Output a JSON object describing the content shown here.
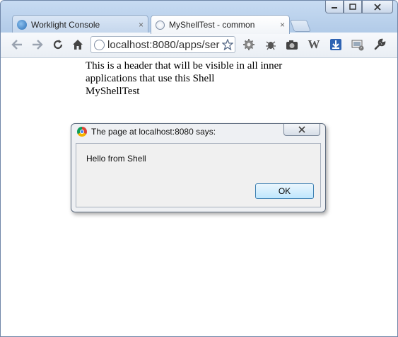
{
  "browser": {
    "tabs": [
      {
        "label": "Worklight Console",
        "icon": "worklight-icon"
      },
      {
        "label": "MyShellTest - common",
        "icon": "globe-icon"
      }
    ],
    "tab_close_glyph": "×",
    "address": {
      "url": "localhost:8080/apps/ser"
    },
    "toolbar_icons": [
      "back-icon",
      "forward-icon",
      "reload-icon",
      "home-icon",
      "star-icon",
      "gear-icon",
      "bug-icon",
      "camera-icon",
      "w-icon",
      "download-icon",
      "monitor-icon",
      "wrench-icon"
    ]
  },
  "page": {
    "header_text": "This is a header that will be visible in all inner applications that use this Shell",
    "app_name": "MyShellTest"
  },
  "dialog": {
    "title": "The page at localhost:8080 says:",
    "message": "Hello from Shell",
    "ok_label": "OK"
  },
  "colors": {
    "window_frame": "#b9d1ea",
    "ok_border": "#3c7fb1"
  }
}
